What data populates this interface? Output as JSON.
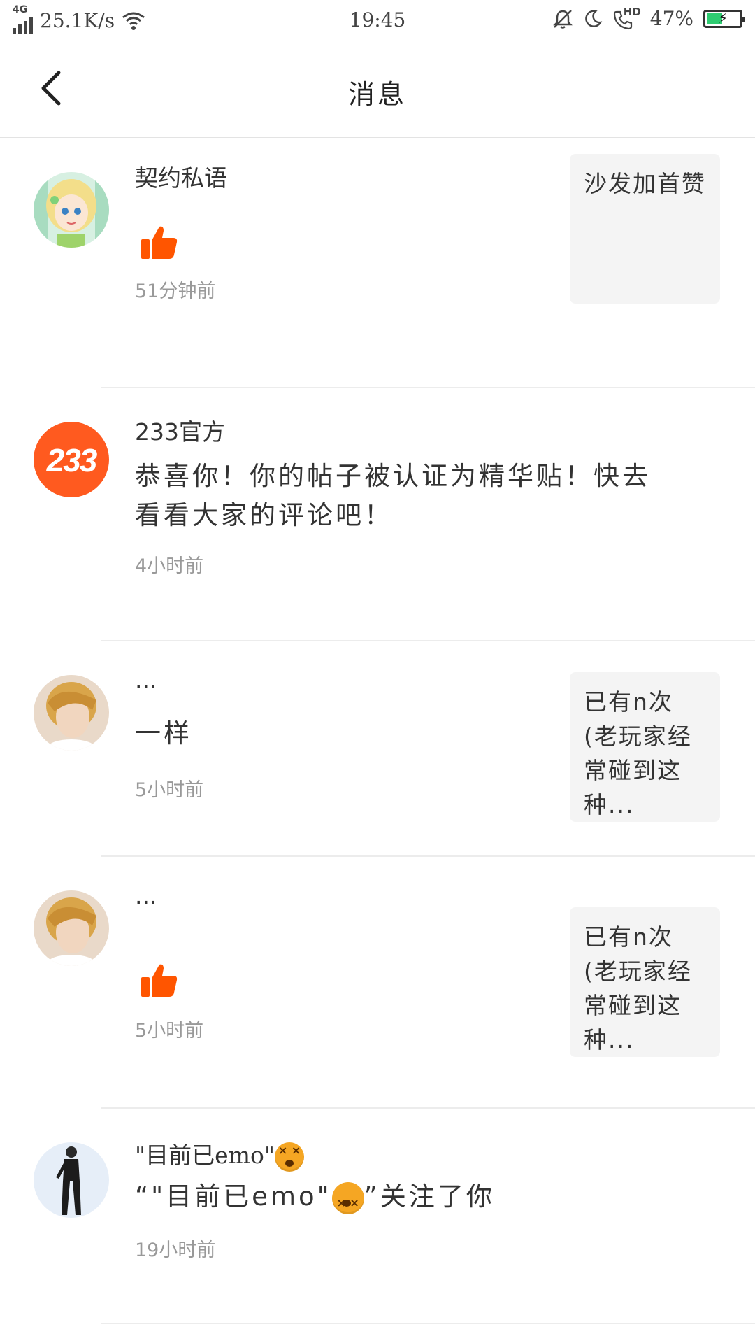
{
  "status_bar": {
    "network": "4G",
    "speed": "25.1K/s",
    "time": "19:45",
    "hd_label": "HD",
    "battery": "47%",
    "battery_level": 0.47,
    "icons": [
      "signal-icon",
      "wifi-icon",
      "bell-off-icon",
      "moon-icon",
      "hd-call-icon",
      "battery-charging-icon"
    ]
  },
  "header": {
    "title": "消息",
    "back_icon": "chevron-left-icon"
  },
  "messages": [
    {
      "username": "契约私语",
      "type": "like",
      "like_icon": "thumbs-up-icon",
      "quote": "沙发加首赞",
      "time": "51分钟前",
      "avatar": "anime-girl-avatar"
    },
    {
      "username": "233官方",
      "type": "text",
      "content": "恭喜你！你的帖子被认证为精华贴！快去看看大家的评论吧！",
      "time": "4小时前",
      "avatar_text": "233",
      "avatar_color": "#ff5a1f"
    },
    {
      "username": "...",
      "type": "text",
      "content": "一样",
      "quote": "已有n次(老玩家经常碰到这种...",
      "time": "5小时前",
      "avatar": "blond-boy-avatar"
    },
    {
      "username": "...",
      "type": "like",
      "like_icon": "thumbs-up-icon",
      "quote": "已有n次(老玩家经常碰到这种...",
      "time": "5小时前",
      "avatar": "blond-boy-avatar"
    },
    {
      "username_text": "\"目前已emo\"",
      "content_prefix": "“\"目前已emo\"",
      "content_suffix": "”关注了你",
      "emoji_icon": "dizzy-face-emoji",
      "type": "follow",
      "time": "19小时前",
      "avatar": "black-outfit-figure-avatar"
    }
  ],
  "colors": {
    "accent": "#ff5a1f",
    "like": "#ff5500",
    "battery_fill": "#2ecc71",
    "quote_bg": "#f4f4f4"
  }
}
